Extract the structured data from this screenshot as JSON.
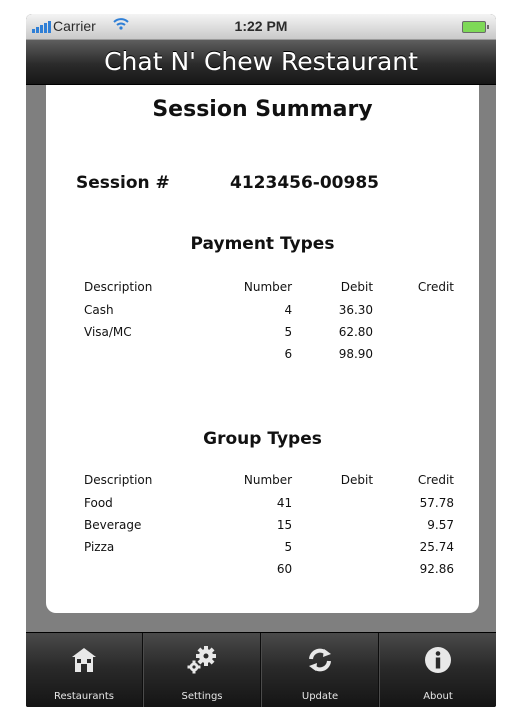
{
  "status_bar": {
    "carrier": "Carrier",
    "time": "1:22 PM"
  },
  "nav": {
    "title": "Chat N' Chew Restaurant"
  },
  "summary": {
    "title": "Session Summary",
    "session_label": "Session #",
    "session_number": "4123456-00985",
    "payment": {
      "title": "Payment Types",
      "headers": [
        "Description",
        "Number",
        "Debit",
        "Credit"
      ],
      "rows": [
        [
          "Cash",
          "4",
          "36.30",
          ""
        ],
        [
          "Visa/MC",
          "5",
          "62.80",
          ""
        ],
        [
          "",
          "6",
          "98.90",
          ""
        ]
      ]
    },
    "group": {
      "title": "Group Types",
      "headers": [
        "Description",
        "Number",
        "Debit",
        "Credit"
      ],
      "rows": [
        [
          "Food",
          "41",
          "",
          "57.78"
        ],
        [
          "Beverage",
          "15",
          "",
          "9.57"
        ],
        [
          "Pizza",
          "5",
          "",
          "25.74"
        ],
        [
          "",
          "60",
          "",
          "92.86"
        ]
      ]
    }
  },
  "tabs": [
    {
      "label": "Restaurants",
      "icon": "restaurant-icon"
    },
    {
      "label": "Settings",
      "icon": "gears-icon"
    },
    {
      "label": "Update",
      "icon": "refresh-icon"
    },
    {
      "label": "About",
      "icon": "info-icon"
    }
  ],
  "colors": {
    "signal": "#2f7fd6",
    "battery": "#7ed957",
    "title_bar": "#2b2b2b",
    "content_bg": "#7f7f7f"
  }
}
